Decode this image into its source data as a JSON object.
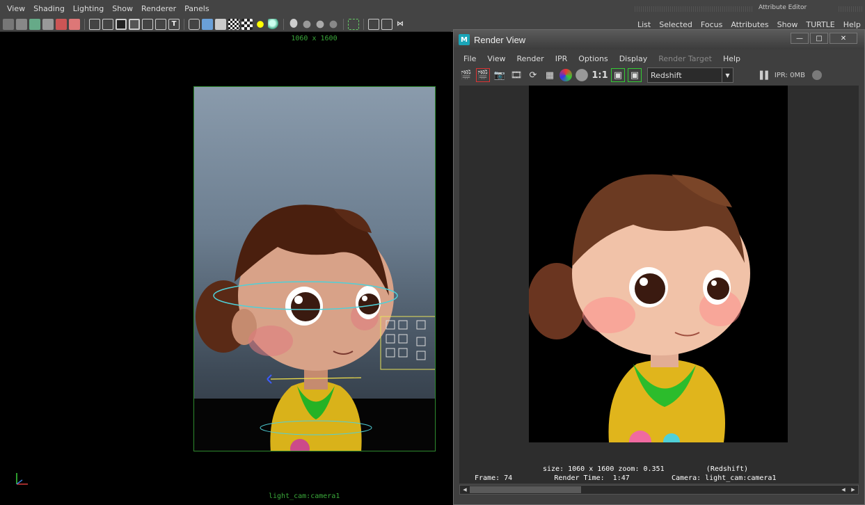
{
  "main_menu": [
    "View",
    "Shading",
    "Lighting",
    "Show",
    "Renderer",
    "Panels"
  ],
  "viewport": {
    "resolution_label": "1060 x 1600",
    "camera_label": "light_cam:camera1"
  },
  "attribute_editor": {
    "title": "Attribute Editor",
    "menu": [
      "List",
      "Selected",
      "Focus",
      "Attributes",
      "Show",
      "TURTLE",
      "Help"
    ]
  },
  "render_view": {
    "title": "Render View",
    "menu": [
      "File",
      "View",
      "Render",
      "IPR",
      "Options",
      "Display",
      "Render Target",
      "Help"
    ],
    "ratio_label": "1:1",
    "renderer": "Redshift",
    "ipr_memory": "IPR: 0MB",
    "info_line1": "size: 1060 x 1600 zoom: 0.351          (Redshift)",
    "info_line2": "Frame: 74          Render Time:  1:47          Camera: light_cam:camera1"
  },
  "colors": {
    "accent_green": "#3aa83a",
    "redshift_frame": "#000000",
    "window_bg": "#3f3f3f"
  }
}
